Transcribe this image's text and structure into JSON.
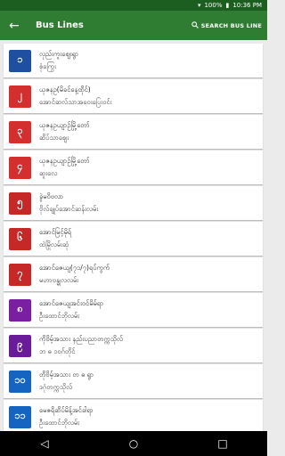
{
  "status": {
    "battery": "100%",
    "time": "10:36 PM"
  },
  "appbar": {
    "title": "Bus Lines",
    "search_label": "SEARCH BUS LINE"
  },
  "colors": {
    "appbar": "#2e7d32",
    "statusbar": "#1b5e20",
    "badges": [
      "#1e4fa0",
      "#d32f2f",
      "#d32f2f",
      "#d32f2f",
      "#c62828",
      "#c62828",
      "#c62828",
      "#7b1fa2",
      "#6a1b9a",
      "#1565c0",
      "#1565c0"
    ]
  },
  "routes": [
    {
      "number": "၁",
      "line1": "လှည်းကူးဈေးရွာ",
      "line2": "စုံကြွေး"
    },
    {
      "number": "၂",
      "line1": "ယုဇနဥ(မိခင်နေ့ထိုင်)",
      "line2": "အောင်ဆလ်သာအဝေးပြေးဝင်း"
    },
    {
      "number": "၃",
      "line1": "ယုဇနဥယျာဉ်မြို့တော်",
      "line2": "ဆိပ်သာဈေး"
    },
    {
      "number": "၄",
      "line1": "ယုဇနဥယျာဉ်မြို့တော်",
      "line2": "ဆူးလေ"
    },
    {
      "number": "၅",
      "line1": "ခွဲမဝိဗလာ",
      "line2": "ဗိုလ်ချုပ်အောင်ဆန်းလမ်း"
    },
    {
      "number": "၆",
      "line1": "အောင်မြင့်မိုရ်",
      "line2": "ထဲမြိုလမ်းဆုံ"
    },
    {
      "number": "၇",
      "line1": "အောင်ဇေယျ(၇၁/၇)ရပ်ကွက်",
      "line2": "မဟာဗန္ဓုလလမ်း"
    },
    {
      "number": "၈",
      "line1": "အောင်ဇေယျအင်းဝင်မိမ်ရာ",
      "line2": "ဦးထောင်ဘိုလမ်း"
    },
    {
      "number": "၉",
      "line1": "ကိုဗိမ့်အသား နည်းပညာတက္ကသိုလ်",
      "line2": "ဘ                              ဓ   ၁၀ဂ်တိုင်"
    },
    {
      "number": "၁၀",
      "line1": "တိုဗိမ့်အသား တ                    ဓ   ရွာ",
      "line2": "ဒဂုံတက္ကသိုလ်"
    },
    {
      "number": "၁၁",
      "line1": "မေဇရိဆိပ်မိန့်အင်ခါရာ",
      "line2": "ဦးထောင်ဘိုလမ်း"
    }
  ],
  "navbar": {
    "back": "◁",
    "home": "○",
    "recents": "□"
  }
}
